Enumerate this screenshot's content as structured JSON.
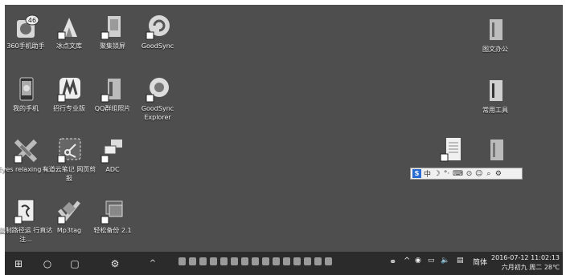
{
  "desktop": {
    "icons": [
      {
        "label": "360手机助手",
        "icon": "360-assistant-icon"
      },
      {
        "label": "冰点文库",
        "icon": "bingdian-wenku-icon"
      },
      {
        "label": "聚集锁屏",
        "icon": "lockscreen-icon"
      },
      {
        "label": "GoodSync",
        "icon": "goodsync-icon"
      },
      {
        "label": "我的手机",
        "icon": "my-phone-icon"
      },
      {
        "label": "招行专业版",
        "icon": "cmb-bank-icon"
      },
      {
        "label": "QQ群组照片",
        "icon": "qq-group-photos-icon"
      },
      {
        "label": "GoodSync Explorer",
        "icon": "goodsync-explorer-icon"
      },
      {
        "label": "Eyes relaxing a...",
        "icon": "eyes-relaxing-icon"
      },
      {
        "label": "有道云笔记 网页剪报",
        "icon": "youdao-clipper-icon"
      },
      {
        "label": "ADC",
        "icon": "adc-icon"
      },
      {
        "label": "复制路径运 行直达注...",
        "icon": "copy-path-icon"
      },
      {
        "label": "Mp3tag",
        "icon": "mp3tag-icon"
      },
      {
        "label": "轻松备份 2.1",
        "icon": "easy-backup-icon"
      },
      {
        "label": "图文办公",
        "icon": "office-folder-icon"
      },
      {
        "label": "常用工具",
        "icon": "tools-folder-icon"
      },
      {
        "label": "",
        "icon": "document-file-icon"
      },
      {
        "label": "",
        "icon": "folder-icon"
      }
    ]
  },
  "ime_bar": {
    "lang": "中",
    "logo": "S",
    "glyphs": [
      "☽",
      "°·",
      "⌨",
      "⊙",
      "☺",
      "⌕",
      "⚙"
    ]
  },
  "taskbar": {
    "start": "⊞",
    "search": "○",
    "taskview": "▢",
    "settings": "⚙",
    "show_hidden": "^",
    "notifications_badge": "46",
    "ime_text": "简体",
    "date": "2016-07-12",
    "time": "11:02:13",
    "subline": "六月初九 周二 28℃"
  },
  "colors": {
    "wallpaper": "#4e4e4e",
    "taskbar": "#2b2b2b",
    "ime_logo": "#2a6bd2"
  }
}
